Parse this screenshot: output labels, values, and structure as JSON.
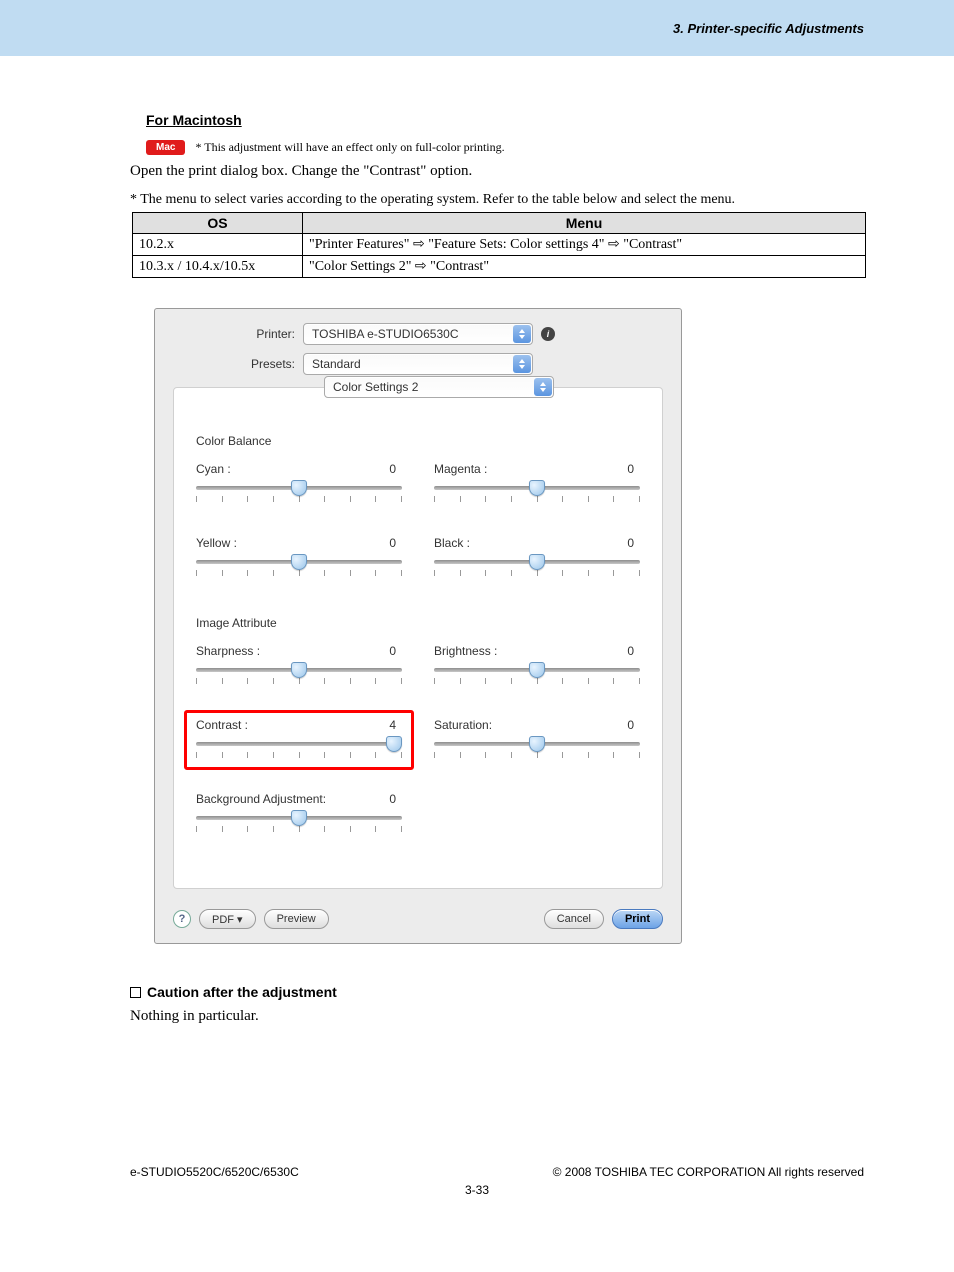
{
  "header": {
    "breadcrumb": "3. Printer-specific Adjustments"
  },
  "section": {
    "title": "For Macintosh",
    "mac_badge": "Mac",
    "note": "* This adjustment will have an effect only on full-color printing.",
    "instruction": "Open the print dialog box.  Change the \"Contrast\" option.",
    "table_note": "* The menu to select varies according to the operating system.  Refer to the table below and select the menu."
  },
  "table": {
    "headers": {
      "os": "OS",
      "menu": "Menu"
    },
    "rows": [
      {
        "os": "10.2.x",
        "menu": "\"Printer Features\" ⇨ \"Feature Sets: Color settings 4\" ⇨ \"Contrast\""
      },
      {
        "os": "10.3.x / 10.4.x/10.5x",
        "menu": "\"Color Settings 2\" ⇨ \"Contrast\""
      }
    ]
  },
  "dialog": {
    "printer_label": "Printer:",
    "printer_value": "TOSHIBA e-STUDIO6530C",
    "presets_label": "Presets:",
    "presets_value": "Standard",
    "settings_value": "Color Settings 2",
    "group1": "Color Balance",
    "group2": "Image Attribute",
    "sliders": {
      "cyan": {
        "label": "Cyan :",
        "value": "0",
        "pos": 50
      },
      "magenta": {
        "label": "Magenta :",
        "value": "0",
        "pos": 50
      },
      "yellow": {
        "label": "Yellow :",
        "value": "0",
        "pos": 50
      },
      "black": {
        "label": "Black :",
        "value": "0",
        "pos": 50
      },
      "sharpness": {
        "label": "Sharpness :",
        "value": "0",
        "pos": 50
      },
      "brightness": {
        "label": "Brightness :",
        "value": "0",
        "pos": 50
      },
      "contrast": {
        "label": "Contrast :",
        "value": "4",
        "pos": 100
      },
      "saturation": {
        "label": "Saturation:",
        "value": "0",
        "pos": 50
      },
      "bgadjust": {
        "label": "Background Adjustment:",
        "value": "0",
        "pos": 50
      }
    },
    "buttons": {
      "pdf": "PDF ▾",
      "preview": "Preview",
      "cancel": "Cancel",
      "print": "Print"
    }
  },
  "caution": {
    "title": "Caution after the adjustment",
    "body": "Nothing in particular."
  },
  "footer": {
    "left": "e-STUDIO5520C/6520C/6530C",
    "right": "© 2008 TOSHIBA TEC CORPORATION All rights reserved",
    "page": "3-33"
  }
}
